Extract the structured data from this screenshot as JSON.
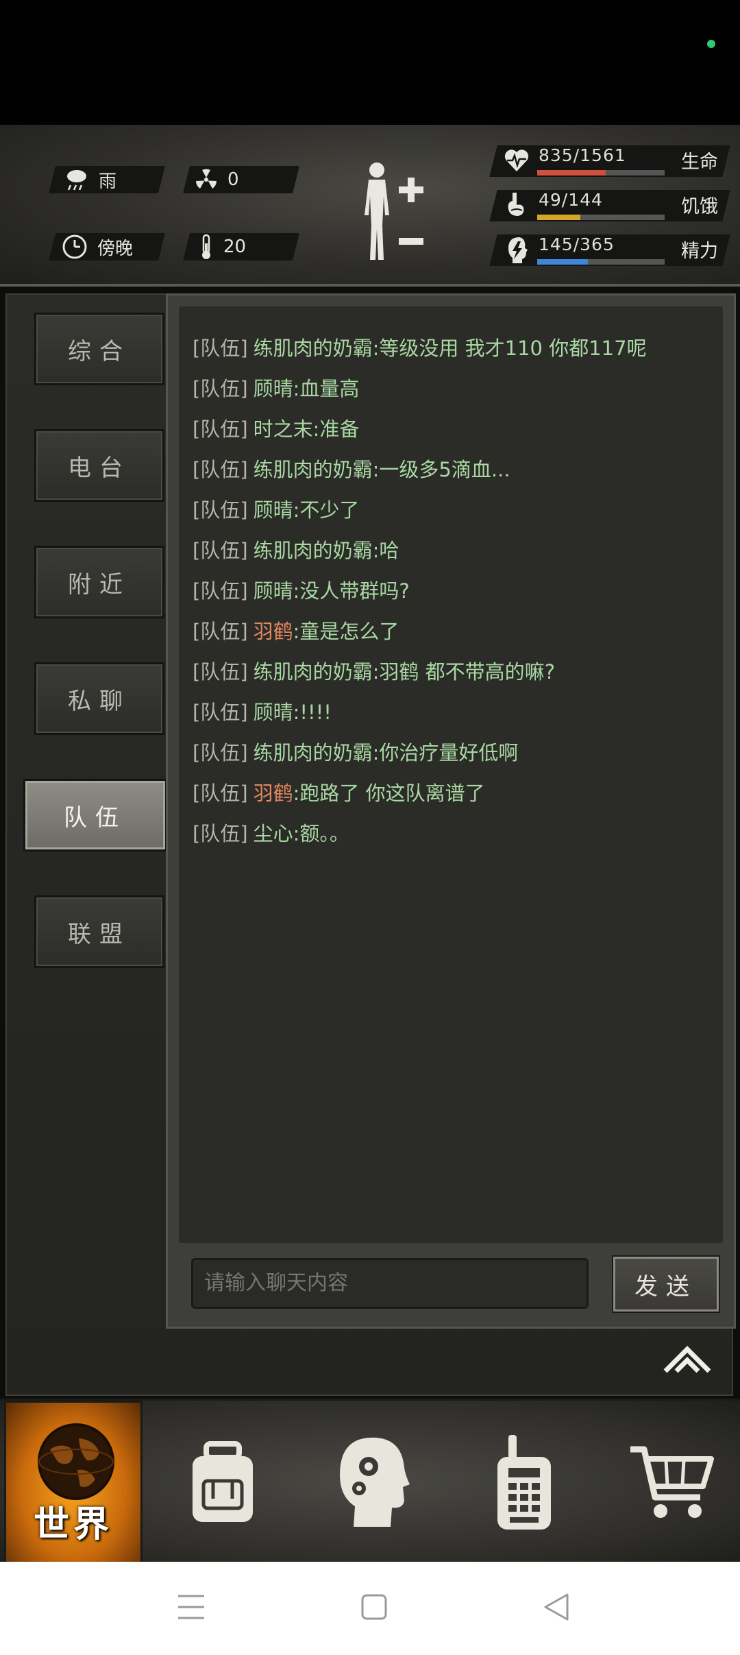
{
  "stats": {
    "weather": {
      "icon": "rain-cloud-icon",
      "label": "雨"
    },
    "radiation": {
      "icon": "radiation-icon",
      "value": "0"
    },
    "time": {
      "icon": "clock-icon",
      "label": "傍晚"
    },
    "temperature": {
      "icon": "thermometer-icon",
      "value": "20"
    },
    "health": {
      "value": "835/1561",
      "label": "生命",
      "fraction": 0.535,
      "color": "#d0503f"
    },
    "hunger": {
      "value": "49/144",
      "label": "饥饿",
      "fraction": 0.34,
      "color": "#d6a629"
    },
    "energy": {
      "value": "145/365",
      "label": "精力",
      "fraction": 0.4,
      "color": "#3f86d6"
    }
  },
  "tabs": [
    {
      "label": "综合",
      "active": false
    },
    {
      "label": "电台",
      "active": false
    },
    {
      "label": "附近",
      "active": false
    },
    {
      "label": "私聊",
      "active": false
    },
    {
      "label": "队伍",
      "active": true
    },
    {
      "label": "联盟",
      "active": false
    }
  ],
  "messages": [
    {
      "tag": "[队伍]",
      "name": "练肌肉的奶霸",
      "text": ":等级没用 我才110 你都117呢",
      "highlight": false
    },
    {
      "tag": "[队伍]",
      "name": "顾晴",
      "text": ":血量高",
      "highlight": false
    },
    {
      "tag": "[队伍]",
      "name": "时之末",
      "text": ":准备",
      "highlight": false
    },
    {
      "tag": "[队伍]",
      "name": "练肌肉的奶霸",
      "text": ":一级多5滴血...",
      "highlight": false
    },
    {
      "tag": "[队伍]",
      "name": "顾晴",
      "text": ":不少了",
      "highlight": false
    },
    {
      "tag": "[队伍]",
      "name": "练肌肉的奶霸",
      "text": ":哈",
      "highlight": false
    },
    {
      "tag": "[队伍]",
      "name": "顾晴",
      "text": ":没人带群吗?",
      "highlight": false
    },
    {
      "tag": "[队伍]",
      "name": "羽鹤",
      "text": ":童是怎么了",
      "highlight": true
    },
    {
      "tag": "[队伍]",
      "name": "练肌肉的奶霸",
      "text": ":羽鹤 都不带高的嘛?",
      "highlight": false
    },
    {
      "tag": "[队伍]",
      "name": "顾晴",
      "text": ":!!!!",
      "highlight": false
    },
    {
      "tag": "[队伍]",
      "name": "练肌肉的奶霸",
      "text": ":你治疗量好低啊",
      "highlight": false
    },
    {
      "tag": "[队伍]",
      "name": "羽鹤",
      "text": ":跑路了 你这队离谱了",
      "highlight": true
    },
    {
      "tag": "[队伍]",
      "name": "尘心",
      "text": ":额。。",
      "highlight": false
    }
  ],
  "chat_input": {
    "placeholder": "请输入聊天内容"
  },
  "send_label": "发送",
  "nav": {
    "world_label": "世界",
    "items": [
      "backpack-icon",
      "brain-skills-icon",
      "walkie-talkie-icon",
      "shopping-cart-icon"
    ]
  }
}
